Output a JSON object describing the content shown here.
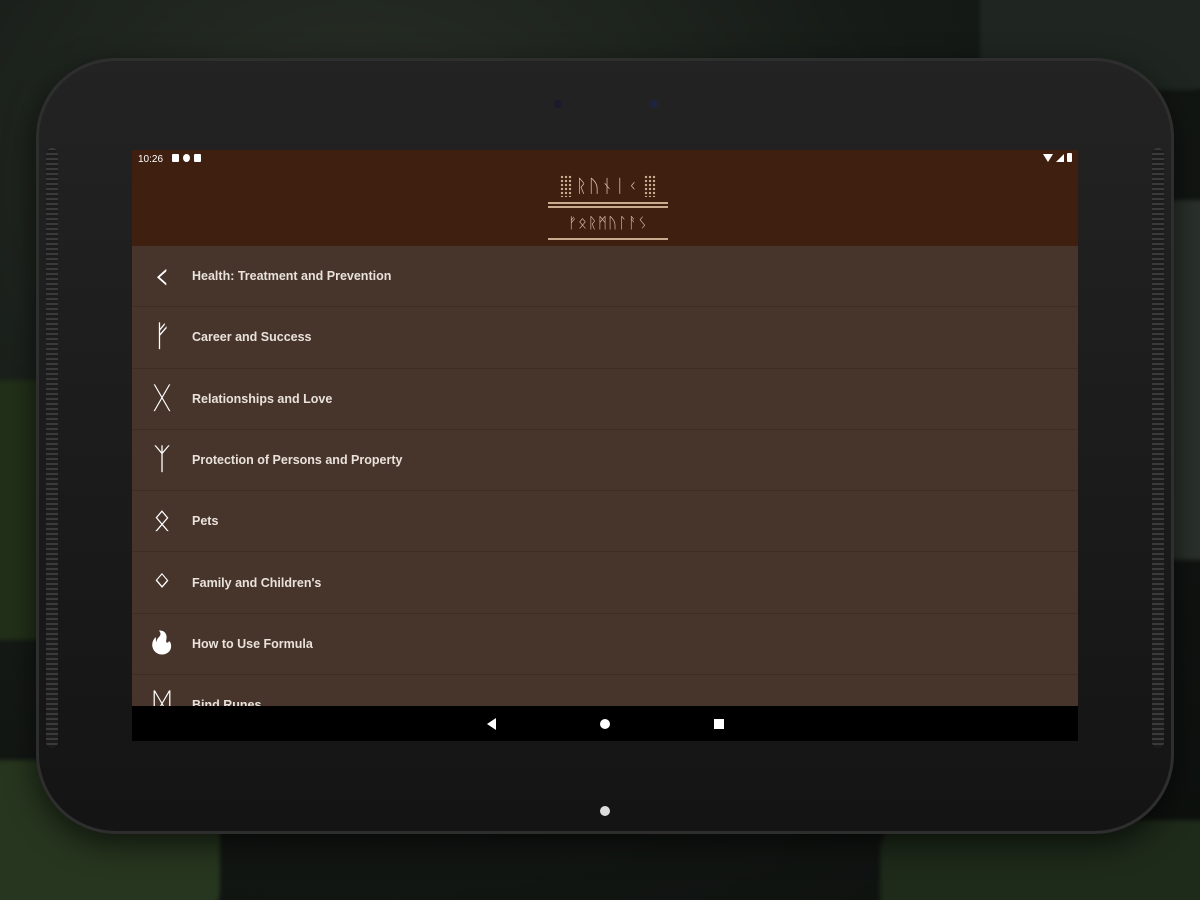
{
  "status": {
    "time": "10:26",
    "left_icons": [
      "notification-icon",
      "sync-icon",
      "storage-icon"
    ],
    "right_icons": [
      "wifi-icon",
      "signal-icon",
      "battery-icon"
    ]
  },
  "header": {
    "logo_line1": "ᚱᚢᚾᛁᚲ",
    "logo_line2": "ᚠᛟᚱᛗᚢᛚᚨᛊ",
    "background": "#3f2010"
  },
  "menu": {
    "background": "#47352b",
    "items": [
      {
        "icon": "back-chevron-icon",
        "glyph": "‹",
        "label": "Health: Treatment and Prevention"
      },
      {
        "icon": "fehu-rune-icon",
        "glyph": "ᚠ",
        "label": "Career and Success"
      },
      {
        "icon": "gebo-rune-icon",
        "glyph": "ᚷ",
        "label": "Relationships and Love"
      },
      {
        "icon": "algiz-rune-icon",
        "glyph": "ᛉ",
        "label": "Protection of Persons and Property"
      },
      {
        "icon": "othala-rune-icon",
        "glyph": "ᛟ",
        "label": "Pets"
      },
      {
        "icon": "ingwaz-rune-icon",
        "glyph": "ᛜ",
        "label": "Family and Children's"
      },
      {
        "icon": "fire-icon",
        "glyph": "🔥",
        "label": "How to Use Formula"
      },
      {
        "icon": "bind-rune-icon",
        "glyph": "ᛞ",
        "label": "Bind Runes"
      }
    ]
  },
  "nav": {
    "back": "back-icon",
    "home": "home-icon",
    "recents": "recents-icon"
  }
}
